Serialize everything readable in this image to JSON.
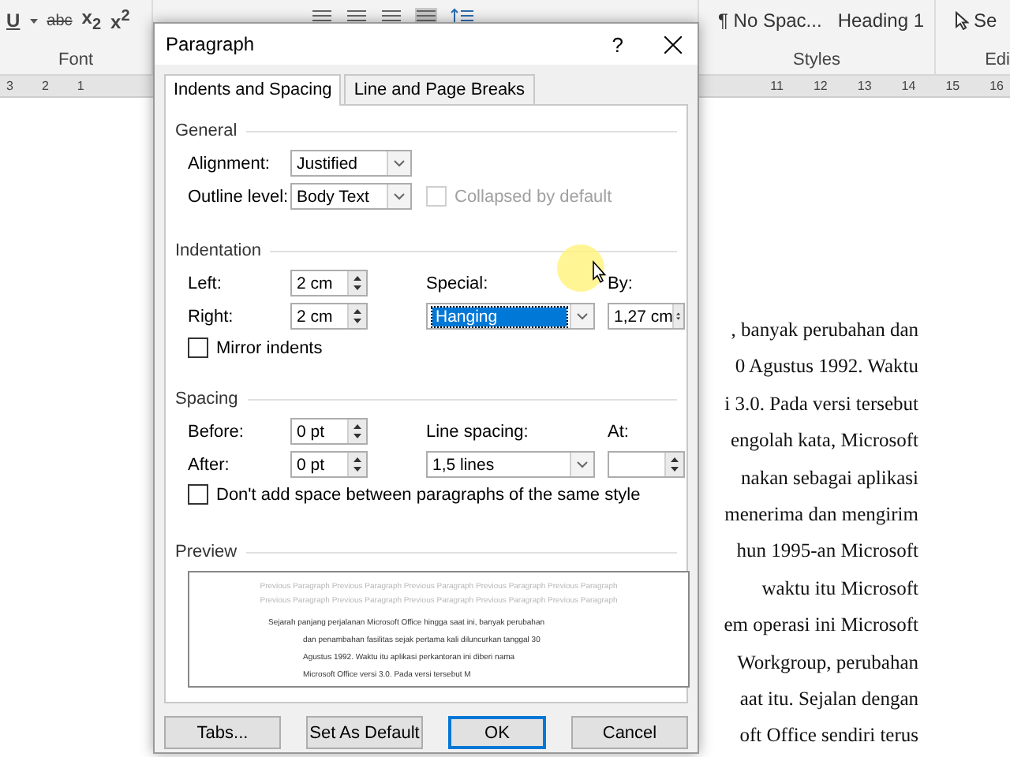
{
  "ribbon": {
    "font_buttons": [
      {
        "kind": "underline",
        "label": "U"
      },
      {
        "kind": "strike",
        "label": "abc"
      },
      {
        "kind": "script",
        "label": "x$_{2}$"
      },
      {
        "kind": "script",
        "label": "x$^{2}$"
      }
    ],
    "font_group": "Font",
    "styles": [
      "¶ No Spac...",
      "Heading 1"
    ],
    "styles_group": "Styles",
    "select_label": "Se",
    "editing_group": "Edi"
  },
  "ruler": {
    "left_numbers": [
      "3",
      "2",
      "1"
    ],
    "right_numbers": [
      "11",
      "12",
      "13",
      "14",
      "15",
      "16"
    ]
  },
  "dialog": {
    "title": "Paragraph",
    "help": "?",
    "tabs": [
      {
        "label": "Indents and Spacing",
        "selected": true
      },
      {
        "label": "Line and Page Breaks",
        "selected": false
      }
    ],
    "general": {
      "heading": "General",
      "alignment": {
        "label": "Alignment:",
        "value": "Justified"
      },
      "outline_level": {
        "label": "Outline level:",
        "value": "Body Text"
      },
      "collapsed": {
        "label": "Collapsed by default",
        "checked": false,
        "disabled": true
      }
    },
    "indentation": {
      "heading": "Indentation",
      "left": {
        "label": "Left:",
        "value": "2 cm"
      },
      "right": {
        "label": "Right:",
        "value": "2 cm"
      },
      "special": {
        "label": "Special:",
        "value": "Hanging",
        "highlighted": true
      },
      "by": {
        "label": "By:",
        "value": "1,27 cm"
      },
      "mirror_indents": {
        "label": "Mirror indents",
        "checked": false
      }
    },
    "spacing": {
      "heading": "Spacing",
      "before": {
        "label": "Before:",
        "value": "0 pt"
      },
      "after": {
        "label": "After:",
        "value": "0 pt"
      },
      "line_spacing": {
        "label": "Line spacing:",
        "value": "1,5 lines"
      },
      "at": {
        "label": "At:"
      },
      "dont_add_space": {
        "label": "Don't add space between paragraphs of the same style",
        "checked": false
      }
    },
    "preview": {
      "heading": "Preview",
      "previous_lines": [
        "Previous Paragraph Previous Paragraph Previous Paragraph Previous Paragraph Previous Paragraph",
        "Previous Paragraph Previous Paragraph Previous Paragraph Previous Paragraph Previous Paragraph"
      ],
      "sample_lines": [
        "Sejarah panjang perjalanan Microsoft Office hingga saat ini, banyak perubahan",
        "dan penambahan fasilitas sejak pertama kali diluncurkan tanggal 30",
        "Agustus 1992. Waktu itu aplikasi perkantoran ini diberi nama",
        "Microsoft Office versi 3.0. Pada versi tersebut M"
      ]
    },
    "buttons": [
      {
        "label": "Tabs...",
        "default": false
      },
      {
        "label": "Set As Default",
        "default": false
      },
      {
        "label": "OK",
        "default": true
      },
      {
        "label": "Cancel",
        "default": false
      }
    ]
  },
  "document_lines": [
    ", banyak perubahan dan",
    "0 Agustus 1992. Waktu",
    "i 3.0. Pada versi tersebut",
    "engolah kata, Microsoft",
    "nakan sebagai aplikasi",
    "menerima dan mengirim",
    "hun 1995-an Microsoft",
    "waktu itu Microsoft",
    "em operasi ini Microsoft",
    "Workgroup, perubahan",
    "aat itu. Sejalan dengan",
    "oft Office sendiri terus"
  ]
}
